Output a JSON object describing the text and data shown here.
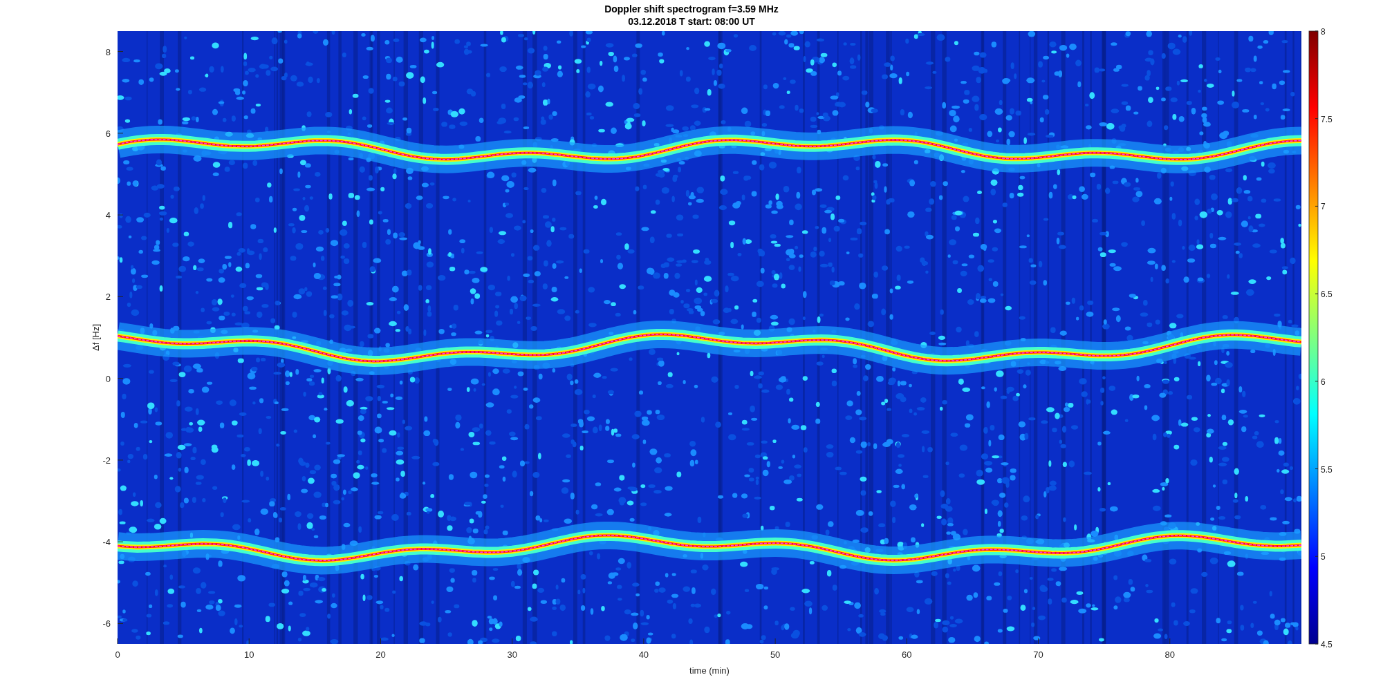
{
  "figure": {
    "title_lines": [
      "Doppler shift spectrogram f=3.59 MHz",
      "03.12.2018   T start: 08:00 UT"
    ],
    "xlabel": "time (min)",
    "ylabel": "Δf [Hz]",
    "xticks": [
      "0",
      "10",
      "20",
      "30",
      "40",
      "50",
      "60",
      "70",
      "80"
    ],
    "yticks": [
      "8",
      "6",
      "4",
      "2",
      "0",
      "-2",
      "-4",
      "-6"
    ]
  },
  "colorbar": {
    "ticks": [
      "8",
      "7.5",
      "7",
      "6.5",
      "6",
      "5.5",
      "5",
      "4.5"
    ]
  }
}
